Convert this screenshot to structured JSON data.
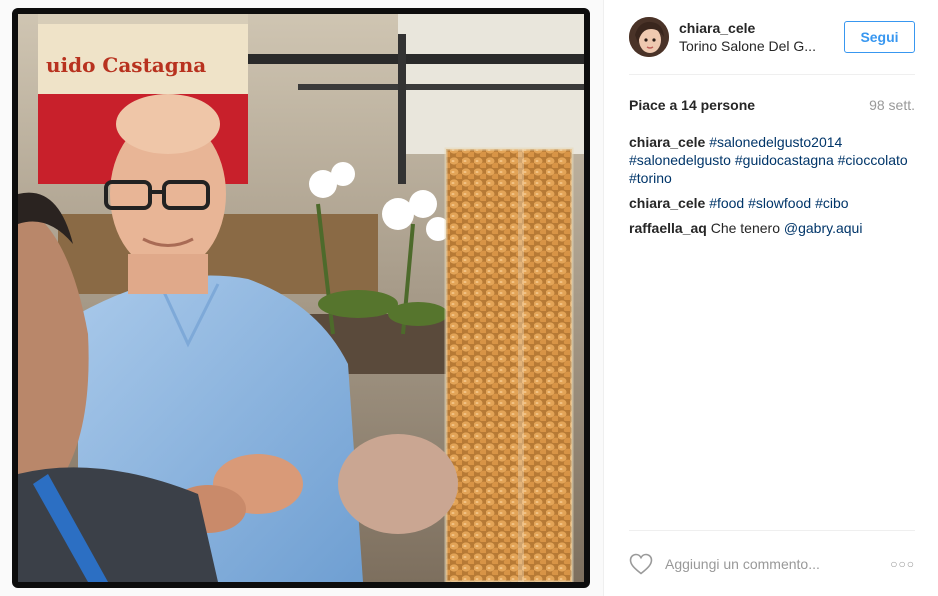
{
  "post": {
    "author": {
      "username": "chiara_cele",
      "location": "Torino Salone Del G..."
    },
    "follow_label": "Segui",
    "likes_text": "Piace a 14 persone",
    "age_text": "98 sett.",
    "photo": {
      "sign_text": "uido Castagna",
      "icons": [
        "heart-icon",
        "more-options-icon"
      ]
    },
    "comments": [
      {
        "author": "chiara_cele",
        "parts": [
          "#salonedelgusto2014",
          "#salonedelgusto",
          "#guidocastagna",
          "#cioccolato",
          "#torino"
        ]
      },
      {
        "author": "chiara_cele",
        "parts": [
          "#food",
          "#slowfood",
          "#cibo"
        ]
      },
      {
        "author": "raffaella_aq",
        "text": "Che tenero",
        "mention": "@gabry.aqui"
      }
    ],
    "add_comment_placeholder": "Aggiungi un commento...",
    "more_label": "○○○"
  },
  "colors": {
    "link": "#003569",
    "button": "#3897f0",
    "muted": "#999999",
    "divider": "#efefef"
  }
}
